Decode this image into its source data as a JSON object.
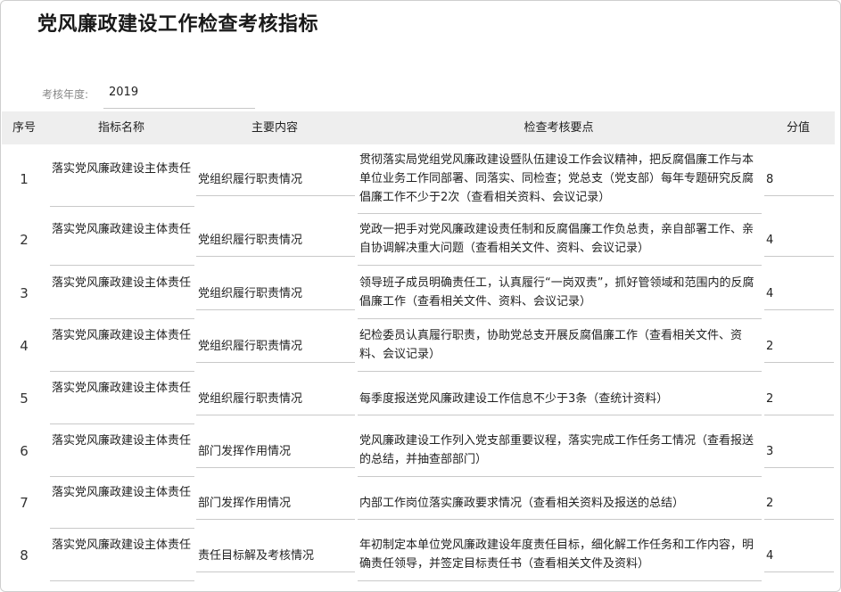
{
  "page": {
    "title": "党风廉政建设工作检查考核指标",
    "year_label": "考核年度:",
    "year_value": "2019"
  },
  "table": {
    "headers": {
      "seq": "序号",
      "name": "指标名称",
      "content": "主要内容",
      "check": "检查考核要点",
      "score": "分值"
    },
    "rows": [
      {
        "seq": "1",
        "name": "落实党风廉政建设主体责任",
        "content": "党组织履行职责情况",
        "check": "贯彻落实局党组党风廉政建设暨队伍建设工作会议精神，把反腐倡廉工作与本单位业务工作同部署、同落实、同检查；党总支（党支部）每年专题研究反腐倡廉工作不少于2次（查看相关资料、会议记录）",
        "score": "8"
      },
      {
        "seq": "2",
        "name": "落实党风廉政建设主体责任",
        "content": "党组织履行职责情况",
        "check": "党政一把手对党风廉政建设责任制和反腐倡廉工作负总责，亲自部署工作、亲自协调解决重大问题（查看相关文件、资料、会议记录）",
        "score": "4"
      },
      {
        "seq": "3",
        "name": "落实党风廉政建设主体责任",
        "content": "党组织履行职责情况",
        "check": "领导班子成员明确责任工，认真履行“一岗双责”，抓好管领域和范围内的反腐倡廉工作（查看相关文件、资料、会议记录）",
        "score": "4"
      },
      {
        "seq": "4",
        "name": "落实党风廉政建设主体责任",
        "content": "党组织履行职责情况",
        "check": "纪检委员认真履行职责，协助党总支开展反腐倡廉工作（查看相关文件、资料、会议记录）",
        "score": "2"
      },
      {
        "seq": "5",
        "name": "落实党风廉政建设主体责任",
        "content": "党组织履行职责情况",
        "check": "每季度报送党风廉政建设工作信息不少于3条（查统计资料）",
        "score": "2"
      },
      {
        "seq": "6",
        "name": "落实党风廉政建设主体责任",
        "content": "部门发挥作用情况",
        "check": "党风廉政建设工作列入党支部重要议程，落实完成工作任务工情况（查看报送的总结，并抽查部部门）",
        "score": "3"
      },
      {
        "seq": "7",
        "name": "落实党风廉政建设主体责任",
        "content": "部门发挥作用情况",
        "check": "内部工作岗位落实廉政要求情况（查看相关资料及报送的总结）",
        "score": "2"
      },
      {
        "seq": "8",
        "name": "落实党风廉政建设主体责任",
        "content": "责任目标解及考核情况",
        "check": "年初制定本单位党风廉政建设年度责任目标，细化解工作任务和工作内容，明确责任领导，并签定目标责任书（查看相关文件及资料）",
        "score": "4"
      }
    ]
  }
}
